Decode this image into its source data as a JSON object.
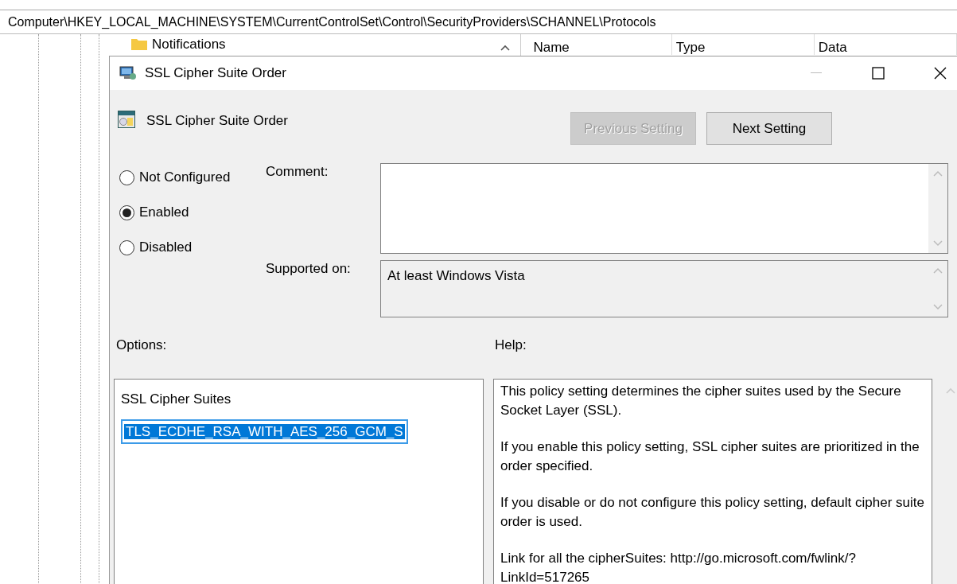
{
  "address_bar": "Computer\\HKEY_LOCAL_MACHINE\\SYSTEM\\CurrentControlSet\\Control\\SecurityProviders\\SCHANNEL\\Protocols",
  "tree": {
    "items": [
      {
        "label": "Notifications"
      }
    ]
  },
  "list_columns": [
    "Name",
    "Type",
    "Data"
  ],
  "dialog": {
    "title": "SSL Cipher Suite Order",
    "setting_title": "SSL Cipher Suite Order",
    "buttons": [
      {
        "label": "Previous Setting",
        "disabled": true
      },
      {
        "label": "Next Setting",
        "disabled": false
      }
    ],
    "states": [
      {
        "label": "Not Configured",
        "selected": false
      },
      {
        "label": "Enabled",
        "selected": true
      },
      {
        "label": "Disabled",
        "selected": false
      }
    ],
    "comment": {
      "label": "Comment:"
    },
    "supported_on": {
      "label": "Supported on:",
      "value": "At least Windows Vista"
    },
    "options": {
      "label": "Options:",
      "field_label": "SSL Cipher Suites",
      "value": "TLS_ECDHE_RSA_WITH_AES_256_GCM_S",
      "highlighted": true
    },
    "help": {
      "label": "Help:",
      "paragraphs": [
        "This policy setting determines the cipher suites used by the Secure Socket Layer (SSL).",
        "If you enable this policy setting, SSL cipher suites are prioritized in the order specified.",
        "If you disable or do not configure this policy setting, default cipher suite order is used.",
        "Link for all the cipherSuites: http://go.microsoft.com/fwlink/?LinkId=517265"
      ]
    }
  }
}
